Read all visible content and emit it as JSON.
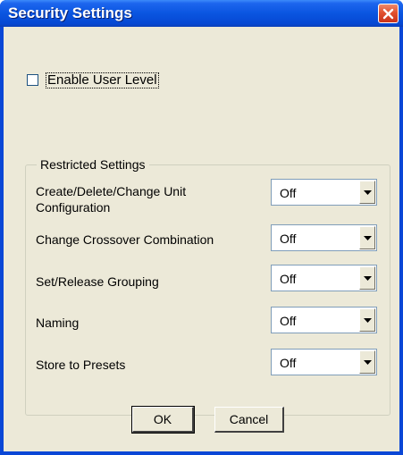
{
  "window": {
    "title": "Security Settings"
  },
  "enable_user_level": {
    "label": "Enable User Level",
    "checked": false
  },
  "restricted_settings": {
    "legend": "Restricted Settings",
    "rows": [
      {
        "label": "Create/Delete/Change Unit Configuration",
        "value": "Off"
      },
      {
        "label": "Change Crossover Combination",
        "value": "Off"
      },
      {
        "label": "Set/Release Grouping",
        "value": "Off"
      },
      {
        "label": "Naming",
        "value": "Off"
      },
      {
        "label": "Store to Presets",
        "value": "Off"
      }
    ]
  },
  "buttons": {
    "ok": "OK",
    "cancel": "Cancel"
  },
  "icons": {
    "close": "close-icon",
    "dropdown": "chevron-down-icon"
  },
  "colors": {
    "titlebar": "#0a55e0",
    "dialog_background": "#ece9d8",
    "close_button": "#e1512f"
  }
}
